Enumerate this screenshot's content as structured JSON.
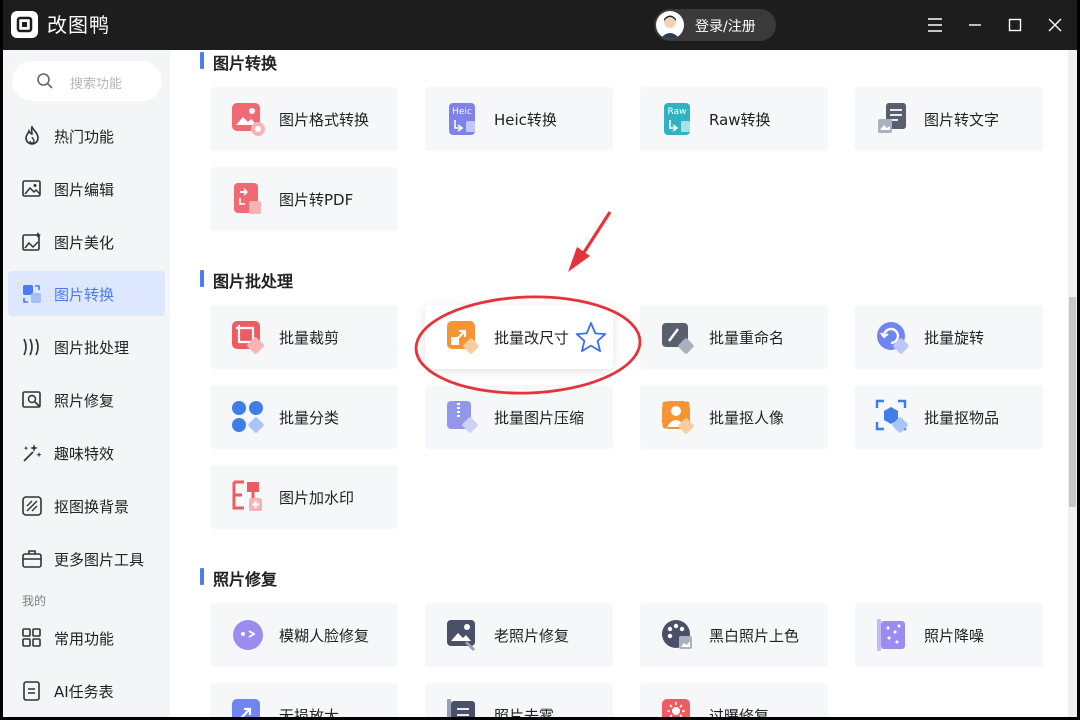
{
  "app": {
    "title": "改图鸭",
    "login_label": "登录/注册"
  },
  "colors": {
    "accent": "#4e7df2",
    "active_bg": "#dde7fd",
    "annotation_red": "#e5333a",
    "card_bg": "#f6f7f9"
  },
  "sidebar": {
    "search_placeholder": "搜索功能",
    "items": [
      {
        "label": "热门功能",
        "icon": "flame-icon"
      },
      {
        "label": "图片编辑",
        "icon": "image-edit-icon"
      },
      {
        "label": "图片美化",
        "icon": "image-beautify-icon"
      },
      {
        "label": "图片转换",
        "icon": "image-convert-icon",
        "active": true
      },
      {
        "label": "图片批处理",
        "icon": "batch-icon"
      },
      {
        "label": "照片修复",
        "icon": "photo-repair-icon"
      },
      {
        "label": "趣味特效",
        "icon": "sparkle-icon"
      },
      {
        "label": "抠图换背景",
        "icon": "cutout-icon"
      },
      {
        "label": "更多图片工具",
        "icon": "toolbox-icon"
      }
    ],
    "section_label": "我的",
    "my_items": [
      {
        "label": "常用功能",
        "icon": "grid-icon"
      },
      {
        "label": "AI任务表",
        "icon": "task-list-icon"
      }
    ]
  },
  "sections": [
    {
      "title": "图片转换",
      "cards": [
        "图片格式转换",
        "Heic转换",
        "Raw转换",
        "图片转文字",
        "图片转PDF"
      ]
    },
    {
      "title": "图片批处理",
      "cards": [
        "批量裁剪",
        "批量改尺寸",
        "批量重命名",
        "批量旋转",
        "批量分类",
        "批量图片压缩",
        "批量抠人像",
        "批量抠物品",
        "图片加水印"
      ]
    },
    {
      "title": "照片修复",
      "cards": [
        "模糊人脸修复",
        "老照片修复",
        "黑白照片上色",
        "照片降噪",
        "无损放大",
        "照片去雾",
        "过曝修复"
      ]
    }
  ],
  "icon_texts": {
    "heic": "Heic",
    "raw": "Raw"
  }
}
